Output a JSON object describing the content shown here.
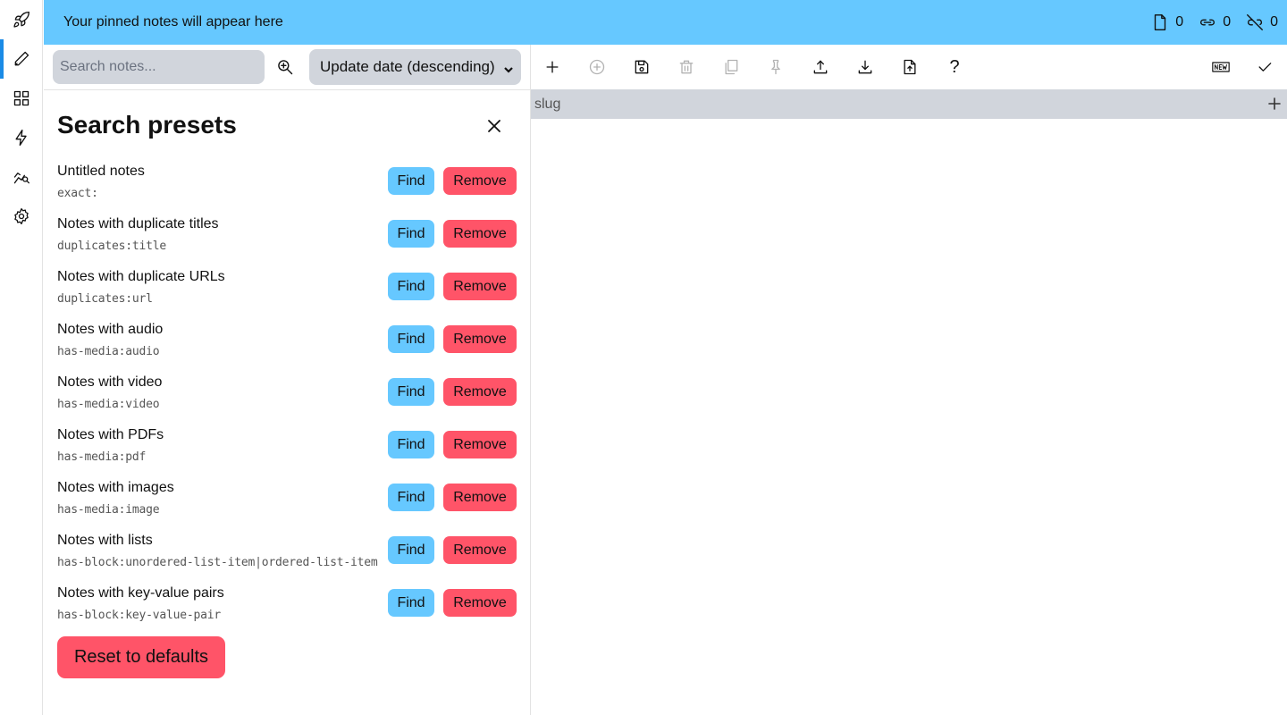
{
  "pinbar": {
    "text": "Your pinned notes will appear here"
  },
  "stats": [
    {
      "icon": "file-icon",
      "value": "0"
    },
    {
      "icon": "link-icon",
      "value": "0"
    },
    {
      "icon": "link-off-icon",
      "value": "0"
    }
  ],
  "sidebar": {
    "items": [
      {
        "icon": "rocket-icon",
        "active": false
      },
      {
        "icon": "pencil-icon",
        "active": true
      },
      {
        "icon": "grid-icon",
        "active": false
      },
      {
        "icon": "lightning-icon",
        "active": false
      },
      {
        "icon": "graph-search-icon",
        "active": false
      },
      {
        "icon": "gear-icon",
        "active": false
      }
    ]
  },
  "search": {
    "placeholder": "Search notes...",
    "sort_value": "Update date (descending)"
  },
  "presets": {
    "title": "Search presets",
    "find_label": "Find",
    "remove_label": "Remove",
    "reset_label": "Reset to defaults",
    "items": [
      {
        "name": "Untitled notes",
        "query": "exact:"
      },
      {
        "name": "Notes with duplicate titles",
        "query": "duplicates:title"
      },
      {
        "name": "Notes with duplicate URLs",
        "query": "duplicates:url"
      },
      {
        "name": "Notes with audio",
        "query": "has-media:audio"
      },
      {
        "name": "Notes with video",
        "query": "has-media:video"
      },
      {
        "name": "Notes with PDFs",
        "query": "has-media:pdf"
      },
      {
        "name": "Notes with images",
        "query": "has-media:image"
      },
      {
        "name": "Notes with lists",
        "query": "has-block:unordered-list-item|ordered-list-item"
      },
      {
        "name": "Notes with key-value pairs",
        "query": "has-block:key-value-pair"
      }
    ]
  },
  "editor": {
    "toolbar": [
      {
        "icon": "plus-icon",
        "enabled": true
      },
      {
        "icon": "add-circle-icon",
        "enabled": false
      },
      {
        "icon": "save-icon",
        "enabled": true
      },
      {
        "icon": "trash-icon",
        "enabled": false
      },
      {
        "icon": "duplicate-icon",
        "enabled": false
      },
      {
        "icon": "pin-icon",
        "enabled": false
      },
      {
        "icon": "upload-icon",
        "enabled": true
      },
      {
        "icon": "download-icon",
        "enabled": true
      },
      {
        "icon": "file-upload-icon",
        "enabled": true
      },
      {
        "icon": "help-icon",
        "enabled": true,
        "text": "?"
      },
      {
        "icon": "new-badge-icon",
        "enabled": true
      },
      {
        "icon": "check-icon",
        "enabled": true
      }
    ],
    "slug_label": "slug"
  }
}
